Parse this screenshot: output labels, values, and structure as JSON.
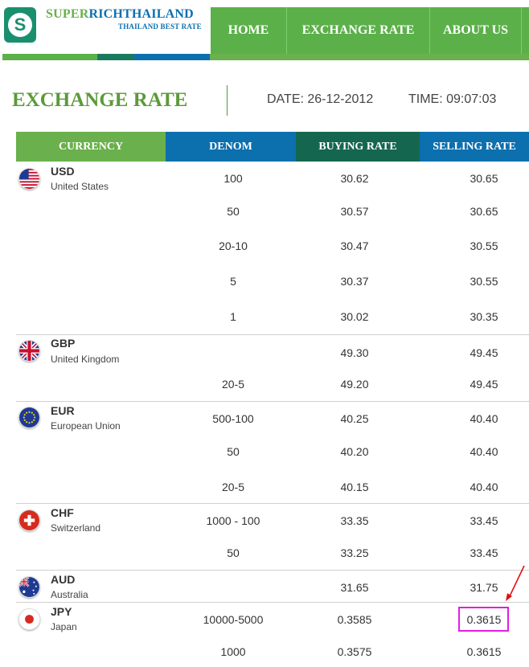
{
  "header": {
    "brand_part1": "SUPER",
    "brand_part2": "RICHTHAILAND",
    "tagline": "THAILAND BEST RATE",
    "nav": [
      "HOME",
      "EXCHANGE RATE",
      "ABOUT US"
    ]
  },
  "title": "EXCHANGE RATE",
  "date": "DATE: 26-12-2012",
  "time": "TIME: 09:07:03",
  "table": {
    "headers": [
      "CURRENCY",
      "DENOM",
      "BUYING RATE",
      "SELLING RATE"
    ],
    "currencies": [
      {
        "code": "USD",
        "name": "United States",
        "flag": "us-flag-icon",
        "rows": [
          {
            "denom": "100",
            "buy": "30.62",
            "sell": "30.65"
          },
          {
            "denom": "50",
            "buy": "30.57",
            "sell": "30.65"
          },
          {
            "denom": "20-10",
            "buy": "30.47",
            "sell": "30.55"
          },
          {
            "denom": "5",
            "buy": "30.37",
            "sell": "30.55"
          },
          {
            "denom": "1",
            "buy": "30.02",
            "sell": "30.35"
          }
        ]
      },
      {
        "code": "GBP",
        "name": "United Kingdom",
        "flag": "uk-flag-icon",
        "rows": [
          {
            "denom": "",
            "buy": "49.30",
            "sell": "49.45"
          },
          {
            "denom": "20-5",
            "buy": "49.20",
            "sell": "49.45"
          }
        ]
      },
      {
        "code": "EUR",
        "name": "European Union",
        "flag": "eu-flag-icon",
        "rows": [
          {
            "denom": "500-100",
            "buy": "40.25",
            "sell": "40.40"
          },
          {
            "denom": "50",
            "buy": "40.20",
            "sell": "40.40"
          },
          {
            "denom": "20-5",
            "buy": "40.15",
            "sell": "40.40"
          }
        ]
      },
      {
        "code": "CHF",
        "name": "Switzerland",
        "flag": "swiss-flag-icon",
        "rows": [
          {
            "denom": "1000 - 100",
            "buy": "33.35",
            "sell": "33.45"
          },
          {
            "denom": "50",
            "buy": "33.25",
            "sell": "33.45"
          }
        ]
      },
      {
        "code": "AUD",
        "name": "Australia",
        "flag": "australia-flag-icon",
        "rows": [
          {
            "denom": "",
            "buy": "31.65",
            "sell": "31.75"
          }
        ]
      },
      {
        "code": "JPY",
        "name": "Japan",
        "flag": "japan-flag-icon",
        "rows": [
          {
            "denom": "10000-5000",
            "buy": "0.3585",
            "sell": "0.3615"
          },
          {
            "denom": "1000",
            "buy": "0.3575",
            "sell": "0.3615"
          }
        ]
      }
    ]
  },
  "colors": {
    "green": "#5bb04a",
    "blue": "#0c6fae",
    "dark_green": "#15664f",
    "highlight": "#e01ee0",
    "arrow": "#e01010"
  }
}
